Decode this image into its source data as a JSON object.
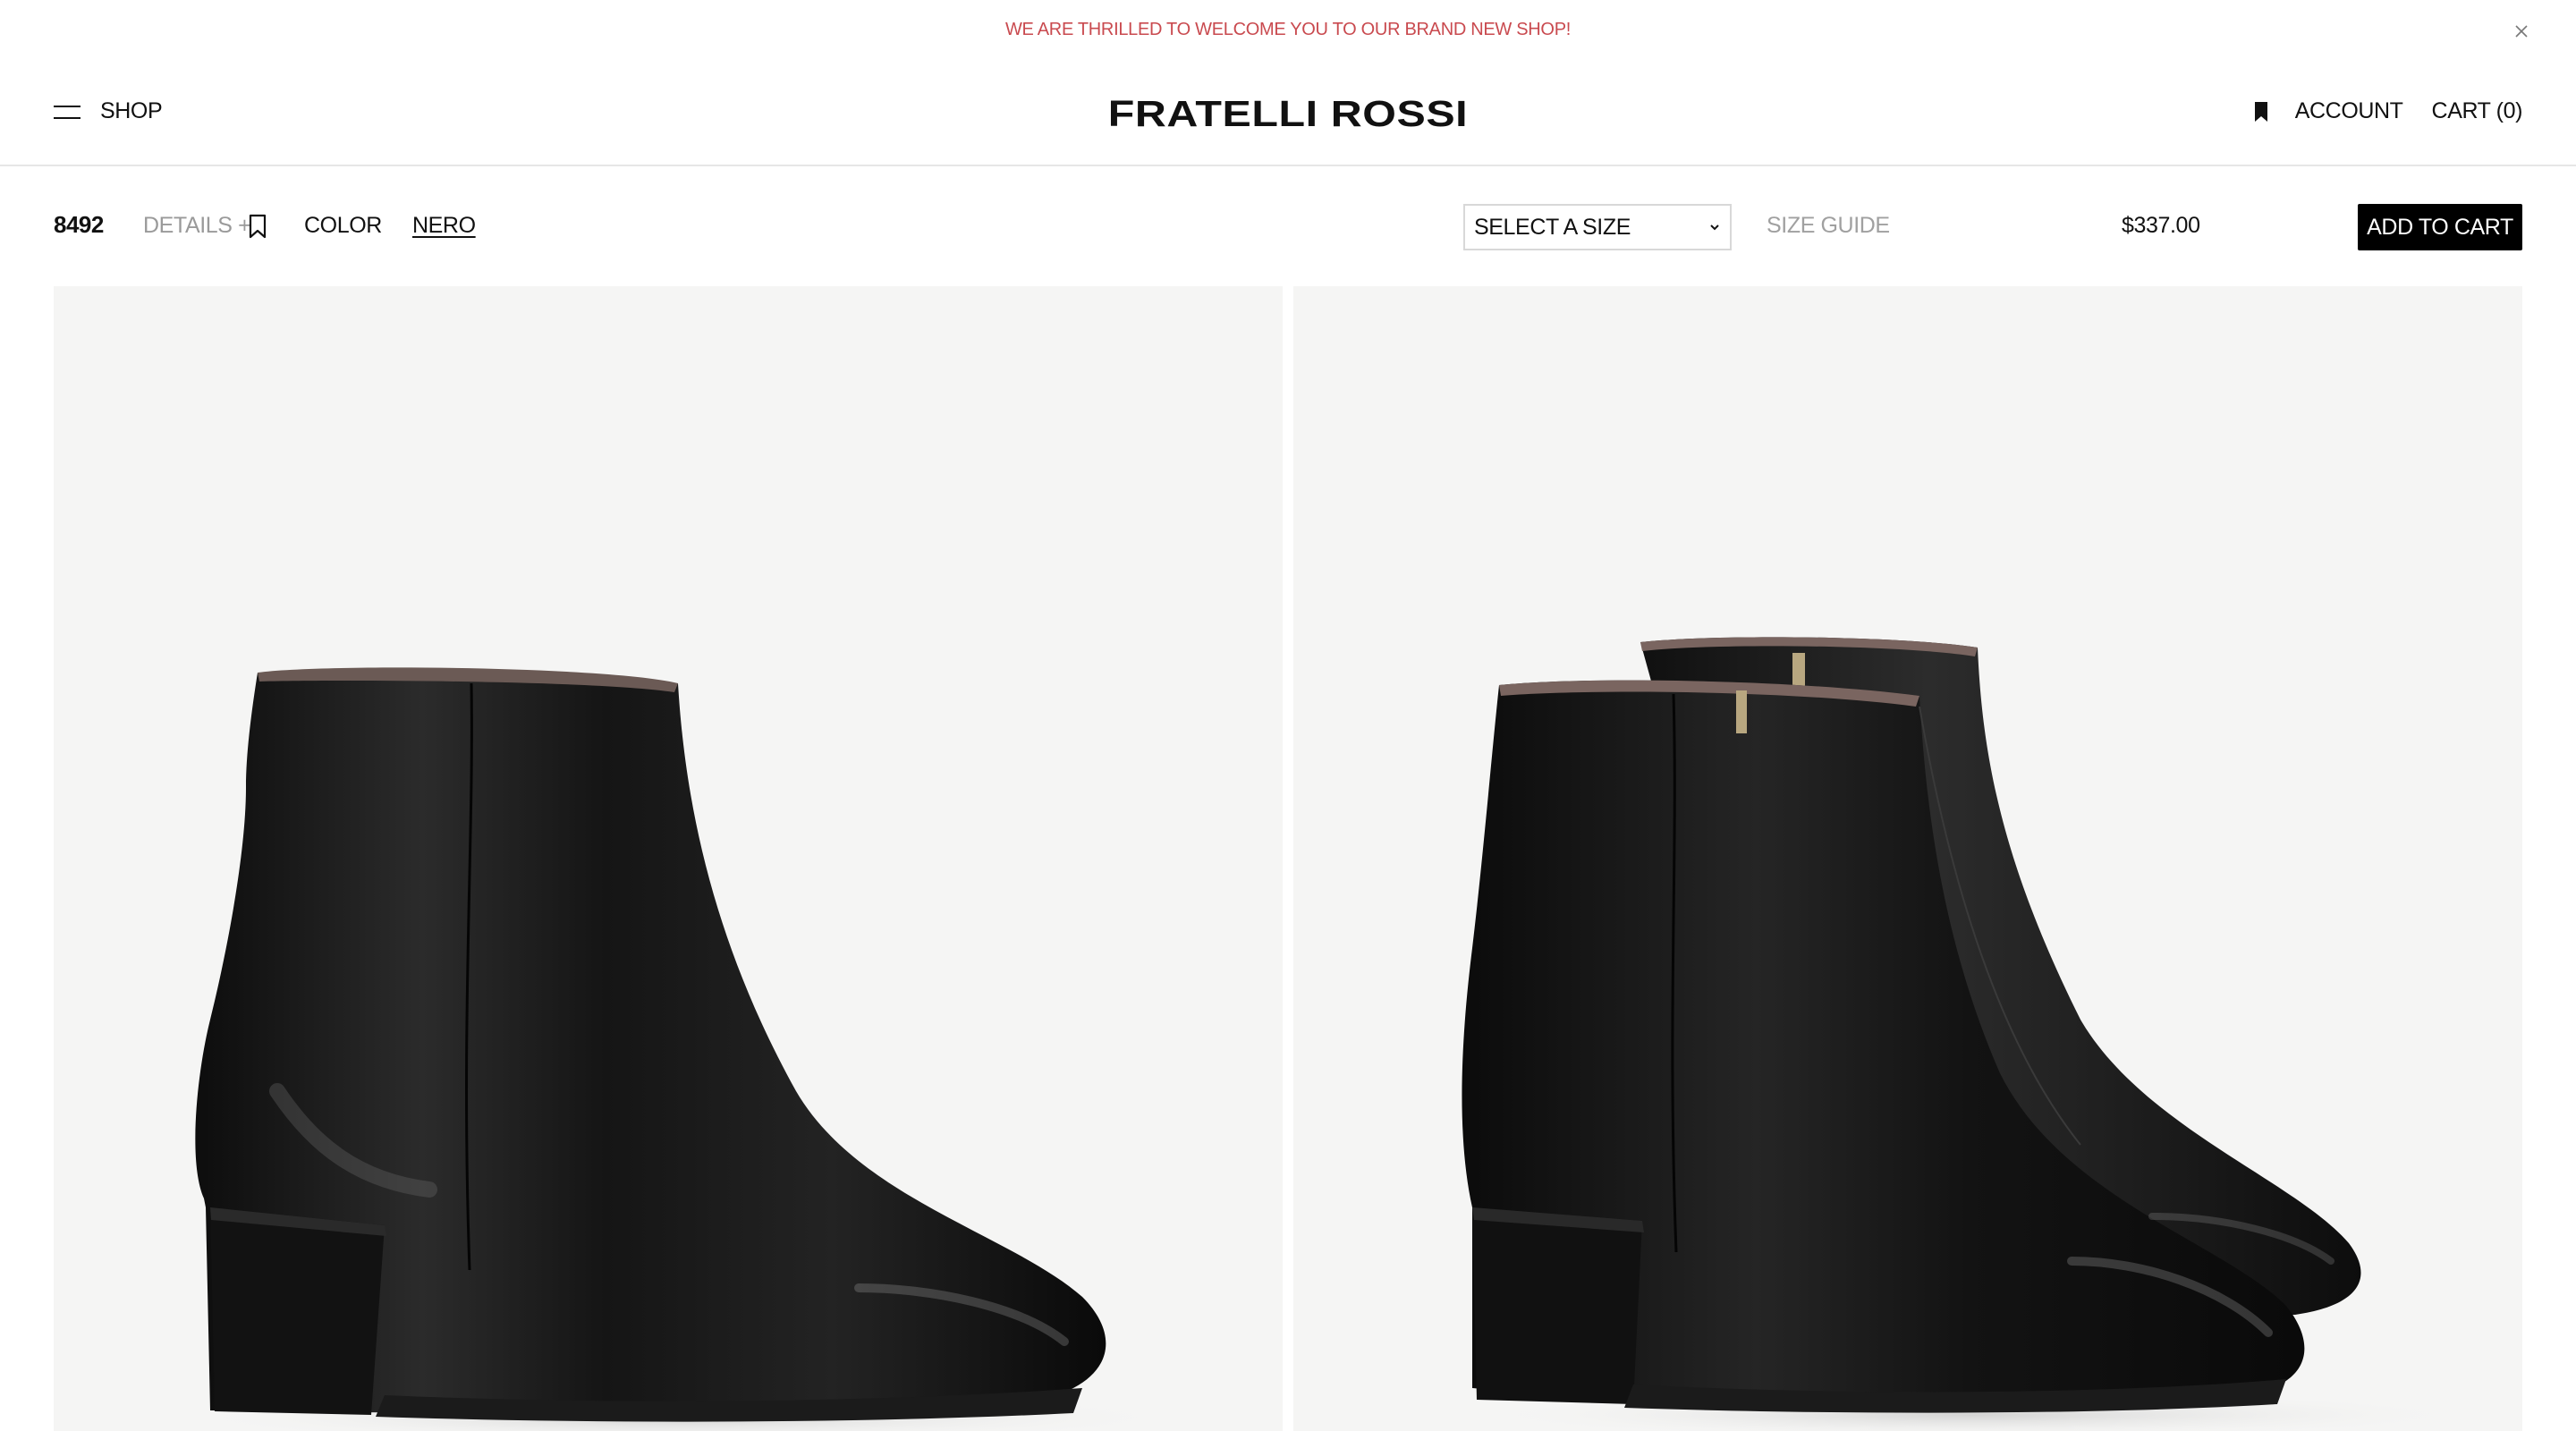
{
  "announcement": {
    "text": "WE ARE THRILLED TO WELCOME YOU TO OUR BRAND NEW SHOP!",
    "color": "#c94a4f",
    "close_icon": "close-icon"
  },
  "header": {
    "menu_label": "SHOP",
    "logo": "FRATELLI ROSSI",
    "account_label": "ACCOUNT",
    "cart_label": "CART (0)",
    "icons": [
      "hamburger-icon",
      "bookmark-icon"
    ]
  },
  "product_bar": {
    "sku": "8492",
    "details_label": "DETAILS +",
    "color_label": "COLOR",
    "color_value": "NERO",
    "size_select": "SELECT A SIZE",
    "size_guide": "SIZE GUIDE",
    "price": "$337.00",
    "add_to_cart": "ADD TO CART"
  },
  "gallery": {
    "images": [
      "black-ankle-boot-side-view",
      "black-ankle-boots-pair-view"
    ],
    "background": "#f5f5f4"
  }
}
